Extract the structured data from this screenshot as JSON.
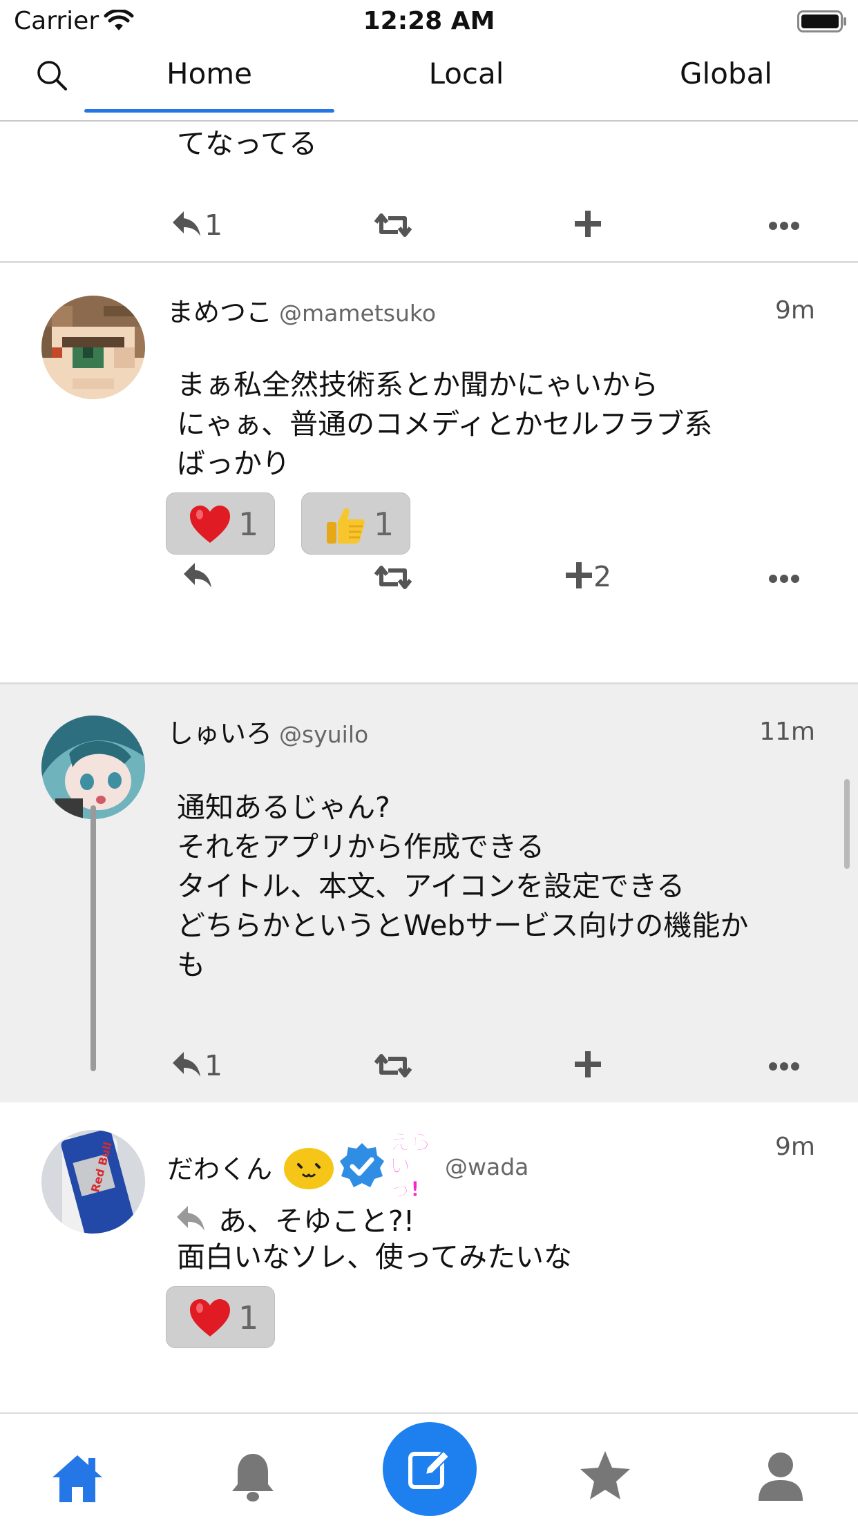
{
  "status_bar": {
    "carrier": "Carrier",
    "time": "12:28 AM"
  },
  "tabs": [
    {
      "label": "Home",
      "active": true
    },
    {
      "label": "Local",
      "active": false
    },
    {
      "label": "Global",
      "active": false
    }
  ],
  "colors": {
    "accent": "#2577e8",
    "highlight_bg": "#efefef",
    "inactive_icon": "#777777"
  },
  "posts": [
    {
      "body": "てなってる",
      "actions": {
        "reply_count": "1",
        "renote_count": "",
        "reaction_count": ""
      }
    },
    {
      "author": "まめつこ",
      "handle": "@mametsuko",
      "time": "9m",
      "body": "まぁ私全然技術系とか聞かにゃいから\nにゃぁ、普通のコメディとかセルフラブ系\nばっかり",
      "reactions": [
        {
          "emoji": "heart",
          "count": "1"
        },
        {
          "emoji": "thumbs-up",
          "count": "1"
        }
      ],
      "actions": {
        "reply_count": "",
        "renote_count": "",
        "reaction_count": "2"
      }
    },
    {
      "author": "しゅいろ",
      "handle": "@syuilo",
      "time": "11m",
      "body": "通知あるじゃん?\nそれをアプリから作成できる\nタイトル、本文、アイコンを設定できる\nどちらかというとWebサービス向けの機能か\nも",
      "actions": {
        "reply_count": "1",
        "renote_count": "",
        "reaction_count": ""
      }
    },
    {
      "author": "だわくん",
      "handle": "@wada",
      "time": "9m",
      "name_badges": [
        "smiley-emoji",
        "verified-badge",
        "erai-sticker"
      ],
      "erai_text": "えら いっ!",
      "reply_line": "あ、そゆこと?!",
      "body": "面白いなソレ、使ってみたいな",
      "reactions": [
        {
          "emoji": "heart",
          "count": "1"
        }
      ]
    }
  ],
  "bottom_nav": [
    "home-icon",
    "bell-icon",
    "compose-icon",
    "star-icon",
    "user-icon"
  ]
}
